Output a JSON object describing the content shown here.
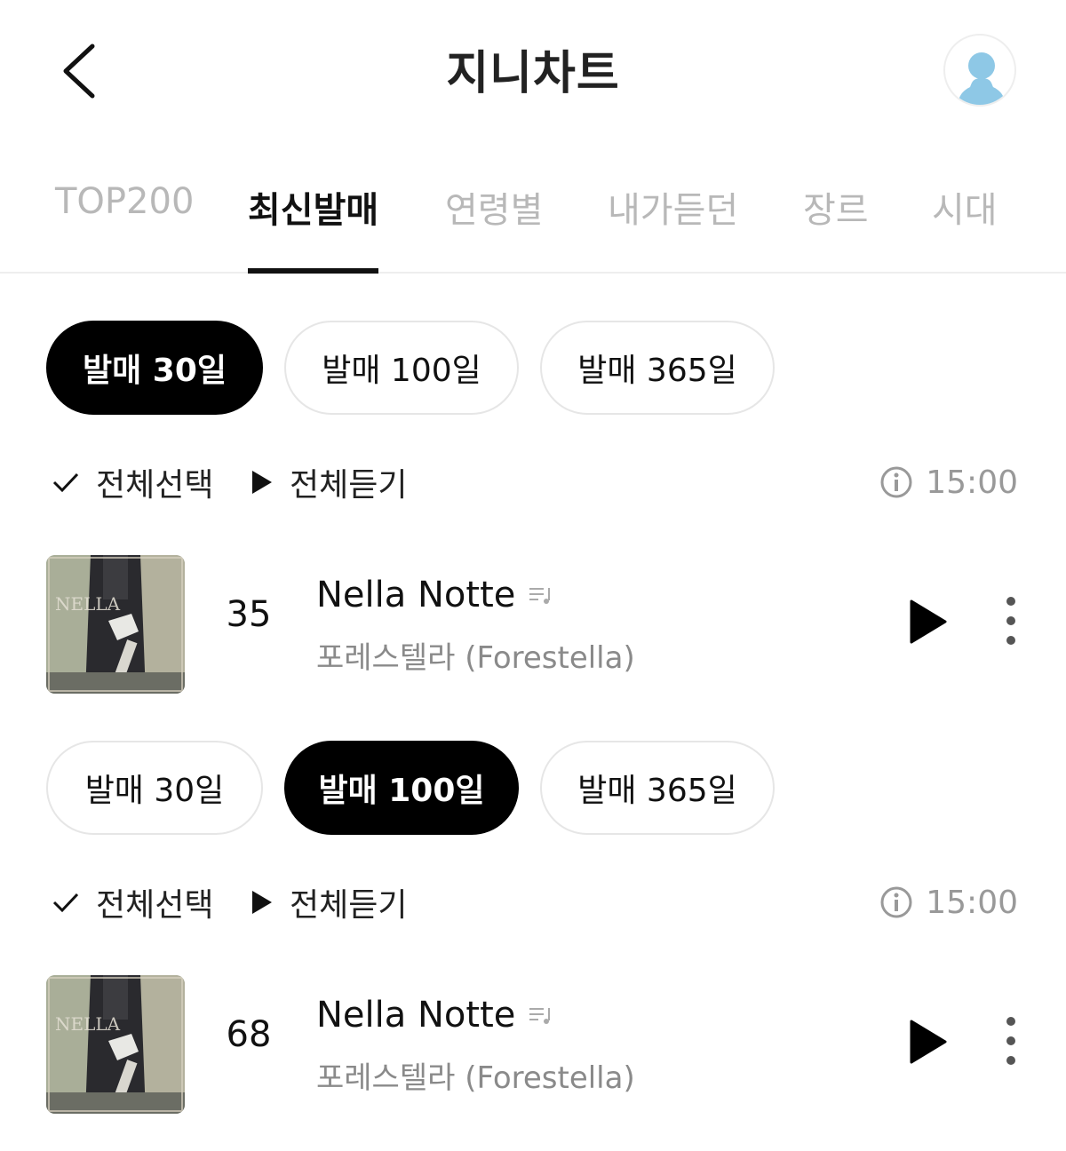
{
  "header": {
    "title": "지니차트",
    "back_icon": "chevron-left-icon",
    "avatar_icon": "user-avatar-icon"
  },
  "tabs": [
    {
      "label": "TOP200",
      "active": false
    },
    {
      "label": "최신발매",
      "active": true
    },
    {
      "label": "연령별",
      "active": false
    },
    {
      "label": "내가듣던",
      "active": false
    },
    {
      "label": "장르",
      "active": false
    },
    {
      "label": "시대",
      "active": false
    }
  ],
  "sections": [
    {
      "filters": [
        {
          "label": "발매 30일",
          "active": true
        },
        {
          "label": "발매 100일",
          "active": false
        },
        {
          "label": "발매 365일",
          "active": false
        }
      ],
      "select_all": "전체선택",
      "play_all": "전체듣기",
      "update_time": "15:00",
      "song": {
        "rank": "35",
        "title": "Nella Notte",
        "artist": "포레스텔라 (Forestella)"
      }
    },
    {
      "filters": [
        {
          "label": "발매 30일",
          "active": false
        },
        {
          "label": "발매 100일",
          "active": true
        },
        {
          "label": "발매 365일",
          "active": false
        }
      ],
      "select_all": "전체선택",
      "play_all": "전체듣기",
      "update_time": "15:00",
      "song": {
        "rank": "68",
        "title": "Nella Notte",
        "artist": "포레스텔라 (Forestella)"
      }
    }
  ],
  "colors": {
    "accent": "#000000",
    "inactive_tab": "#b8b8b8",
    "artist_text": "#8a8a8a",
    "avatar": "#8ec8e6"
  }
}
